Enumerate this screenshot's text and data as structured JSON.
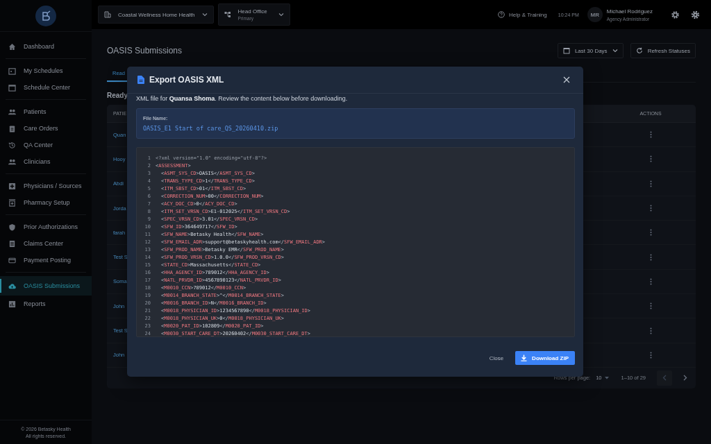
{
  "topbar": {
    "organization": "Coastal Wellness Home Health",
    "branch": {
      "name": "Head Office",
      "subtitle": "Primary"
    },
    "help": "Help & Training",
    "time": "10:24 PM",
    "user": {
      "initials": "MR",
      "name": "Michael Rodriguez",
      "role": "Agency Administrator"
    }
  },
  "sidebar": {
    "groups": [
      [
        {
          "label": "Dashboard",
          "selected": false
        }
      ],
      [
        {
          "label": "My Schedules",
          "selected": false
        },
        {
          "label": "Schedule Center",
          "selected": false
        }
      ],
      [
        {
          "label": "Patients",
          "selected": false
        },
        {
          "label": "Care Orders",
          "selected": false
        },
        {
          "label": "QA Center",
          "selected": false
        },
        {
          "label": "Clinicians",
          "selected": false
        }
      ],
      [
        {
          "label": "Physicians / Sources",
          "selected": false
        },
        {
          "label": "Pharmacy Setup",
          "selected": false
        }
      ],
      [
        {
          "label": "Prior Authorizations",
          "selected": false
        },
        {
          "label": "Claims Center",
          "selected": false
        },
        {
          "label": "Payment Posting",
          "selected": false
        }
      ],
      [
        {
          "label": "OASIS Submissions",
          "selected": true
        },
        {
          "label": "Reports",
          "selected": false
        }
      ]
    ],
    "footer": [
      "© 2026 Betasky Health",
      "All rights reserved."
    ]
  },
  "page": {
    "title": "OASIS Submissions",
    "date_range": "Last 30 Days",
    "refresh": "Refresh Statuses",
    "tabs": [
      {
        "label": "Read",
        "selected": true
      }
    ],
    "section_title": "Ready",
    "table": {
      "columns": [
        "PATIE",
        "ACTIONS"
      ],
      "rows": [
        {
          "patient": "Quan"
        },
        {
          "patient": "Hooy"
        },
        {
          "patient": "Abdi"
        },
        {
          "patient": "Jorda"
        },
        {
          "patient": "farah"
        },
        {
          "patient": "Test S"
        },
        {
          "patient": "Soma"
        },
        {
          "patient": "John"
        },
        {
          "patient": "Test S"
        },
        {
          "patient": "John"
        }
      ]
    },
    "pagination": {
      "rows_per_page_label": "Rows per page:",
      "rows_per_page": "10",
      "range": "1–10 of 29"
    }
  },
  "modal": {
    "title": "Export OASIS XML",
    "description": "XML file for **Quansa Shoma**. Review the content below before downloading.",
    "file_name_label": "File Name:",
    "file_name": "OASIS_E1 Start of care_QS_20260410.zip",
    "xml_lines": [
      {
        "number": "1",
        "kind": "declaration",
        "text": "<?xml version=\"1.0\" encoding=\"utf-8\"?>"
      },
      {
        "number": "2",
        "kind": "element",
        "text": "<ASSESSMENT>",
        "children": [
          {
            "number": "3",
            "kind": "element",
            "text": "<ASMT_SYS_CD>OASIS</ASMT_SYS_CD>"
          },
          {
            "number": "4",
            "kind": "element",
            "text": "<TRANS_TYPE_CD>1</TRANS_TYPE_CD>"
          },
          {
            "number": "5",
            "kind": "element",
            "text": "<ITM_SBST_CD>01</ITM_SBST_CD>"
          },
          {
            "number": "6",
            "kind": "element",
            "text": "<CORRECTION_NUM>00</CORRECTION_NUM>"
          },
          {
            "number": "7",
            "kind": "element",
            "text": "<ACY_DOC_CD>0</ACY_DOC_CD>"
          },
          {
            "number": "8",
            "kind": "element",
            "text": "<ITM_SET_VRSN_CD>E1-012025</ITM_SET_VRSN_CD>"
          },
          {
            "number": "9",
            "kind": "element",
            "text": "<SPEC_VRSN_CD>3.01</SPEC_VRSN_CD>"
          },
          {
            "number": "10",
            "kind": "element",
            "text": "<SFW_ID>364649717</SFW_ID>"
          },
          {
            "number": "11",
            "kind": "element",
            "text": "<SFW_NAME>Betasky Health</SFW_NAME>"
          },
          {
            "number": "12",
            "kind": "element",
            "text": "<SFW_EMAIL_ADR>support@betaskyhealth.com</SFW_EMAIL_ADR>"
          },
          {
            "number": "13",
            "kind": "element",
            "text": "<SFW_PROD_NAME>Betasky EMR</SFW_PROD_NAME>"
          },
          {
            "number": "14",
            "kind": "element",
            "text": "<SFW_PROD_VRSN_CD>1.0.0</SFW_PROD_VRSN_CD>"
          },
          {
            "number": "15",
            "kind": "element",
            "text": "<STATE_CD>Massachusetts</STATE_CD>"
          },
          {
            "number": "16",
            "kind": "element",
            "text": "<HHA_AGENCY_ID>789012</HHA_AGENCY_ID>"
          },
          {
            "number": "17",
            "kind": "element",
            "text": "<NATL_PRVDR_ID>4567890123</NATL_PRVDR_ID>"
          },
          {
            "number": "18",
            "kind": "element",
            "text": "<M0010_CCN>789012</M0010_CCN>"
          },
          {
            "number": "19",
            "kind": "element",
            "text": "<M0014_BRANCH_STATE>^</M0014_BRANCH_STATE>"
          },
          {
            "number": "20",
            "kind": "element",
            "text": "<M0016_BRANCH_ID>N</M0016_BRANCH_ID>"
          },
          {
            "number": "21",
            "kind": "element",
            "text": "<M0018_PHYSICIAN_ID>1234567890</M0018_PHYSICIAN_ID>"
          },
          {
            "number": "22",
            "kind": "element",
            "text": "<M0018_PHYSICIAN_UK>0</M0018_PHYSICIAN_UK>"
          },
          {
            "number": "23",
            "kind": "element",
            "text": "<M0020_PAT_ID>102809</M0020_PAT_ID>"
          },
          {
            "number": "24",
            "kind": "element",
            "text": "<M0030_START_CARE_DT>20260402</M0030_START_CARE_DT>"
          }
        ]
      }
    ],
    "close": "Close",
    "download": "Download ZIP"
  }
}
